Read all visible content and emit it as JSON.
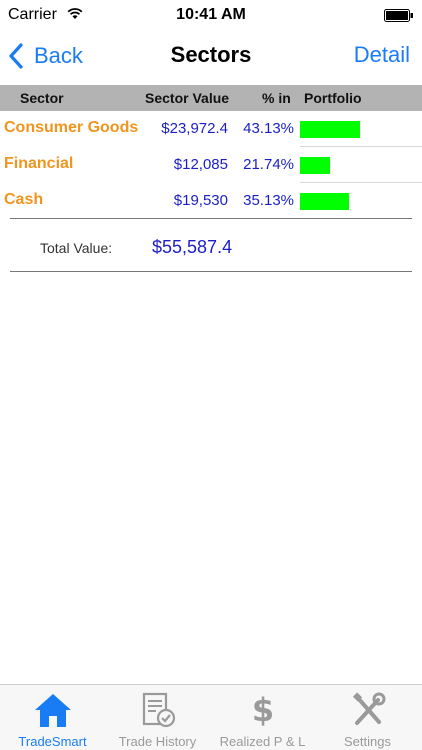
{
  "status": {
    "carrier": "Carrier",
    "time": "10:41 AM"
  },
  "nav": {
    "back_label": "Back",
    "title": "Sectors",
    "detail_label": "Detail"
  },
  "table": {
    "headers": {
      "sector": "Sector",
      "value": "Sector Value",
      "percent": "%  in",
      "portfolio": "Portfolio"
    },
    "rows": [
      {
        "sector": "Consumer Goods",
        "value": "$23,972.4",
        "percent": "43.13%",
        "fraction": 0.4313
      },
      {
        "sector": "Financial",
        "value": "$12,085",
        "percent": "21.74%",
        "fraction": 0.2174
      },
      {
        "sector": "Cash",
        "value": "$19,530",
        "percent": "35.13%",
        "fraction": 0.3513
      }
    ]
  },
  "total": {
    "label": "Total Value:",
    "value": "$55,587.4"
  },
  "tabs": [
    {
      "label": "TradeSmart",
      "icon": "home-icon",
      "active": true
    },
    {
      "label": "Trade History",
      "icon": "trade-history-icon",
      "active": false
    },
    {
      "label": "Realized P & L",
      "icon": "dollar-icon",
      "active": false
    },
    {
      "label": "Settings",
      "icon": "settings-tools-icon",
      "active": false
    }
  ],
  "colors": {
    "accent": "#1a7cf5",
    "sector_text": "#f0951e",
    "value_text": "#1b1ec8",
    "bar": "#00ff00",
    "header_bg": "#b3b3b3"
  }
}
